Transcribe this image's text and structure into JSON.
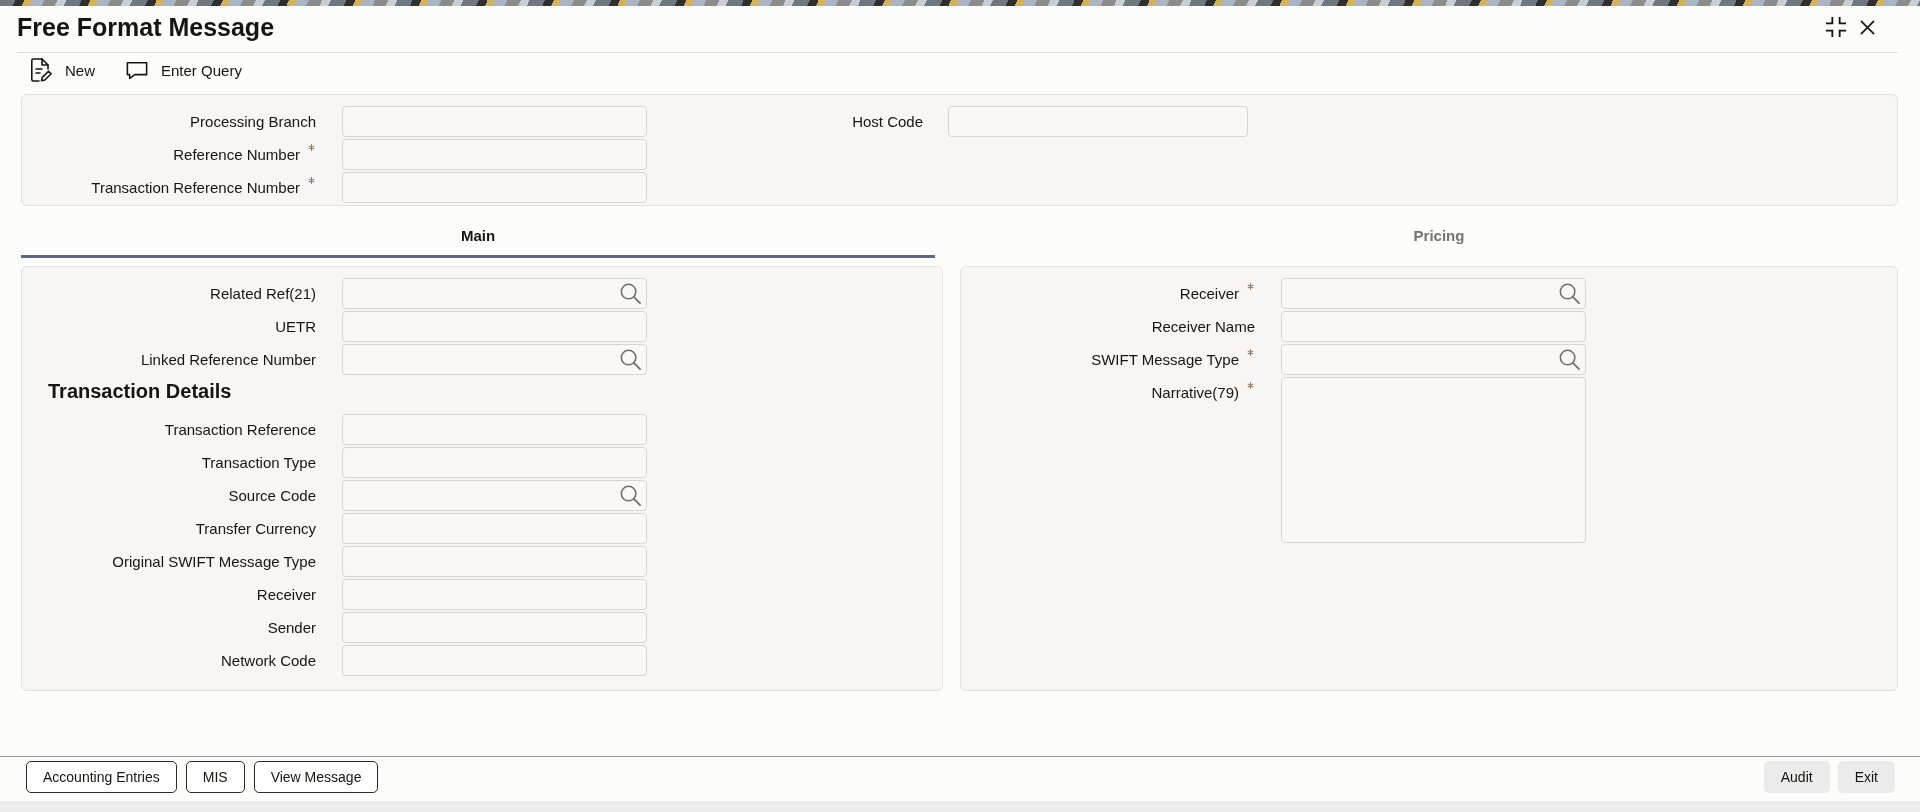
{
  "window": {
    "title": "Free Format Message"
  },
  "toolbar": [
    {
      "kind": "new",
      "label": "New"
    },
    {
      "kind": "query",
      "label": "Enter Query"
    }
  ],
  "header_fields": {
    "left": [
      {
        "label": "Processing Branch",
        "required": false,
        "kind": "text"
      },
      {
        "label": "Reference Number",
        "required": true,
        "kind": "text"
      },
      {
        "label": "Transaction Reference Number",
        "required": true,
        "kind": "text"
      }
    ],
    "right": [
      {
        "label": "Host Code",
        "required": false,
        "kind": "text"
      }
    ]
  },
  "tabs": [
    {
      "label": "Main",
      "selected": true
    },
    {
      "label": "Pricing",
      "selected": false
    }
  ],
  "main_panel": {
    "fields": [
      {
        "label": "Related Ref(21)",
        "required": false,
        "kind": "lookup"
      },
      {
        "label": "UETR",
        "required": false,
        "kind": "text"
      },
      {
        "label": "Linked Reference Number",
        "required": false,
        "kind": "lookup"
      }
    ],
    "section_title": "Transaction Details",
    "section_fields": [
      {
        "label": "Transaction Reference",
        "required": false,
        "kind": "text"
      },
      {
        "label": "Transaction Type",
        "required": false,
        "kind": "text"
      },
      {
        "label": "Source Code",
        "required": false,
        "kind": "lookup"
      },
      {
        "label": "Transfer Currency",
        "required": false,
        "kind": "text"
      },
      {
        "label": "Original SWIFT Message Type",
        "required": false,
        "kind": "text"
      },
      {
        "label": "Receiver",
        "required": false,
        "kind": "text"
      },
      {
        "label": "Sender",
        "required": false,
        "kind": "text"
      },
      {
        "label": "Network Code",
        "required": false,
        "kind": "text"
      }
    ]
  },
  "pricing_panel": {
    "fields": [
      {
        "label": "Receiver",
        "required": true,
        "kind": "lookup"
      },
      {
        "label": "Receiver Name",
        "required": false,
        "kind": "text"
      },
      {
        "label": "SWIFT Message Type",
        "required": true,
        "kind": "lookup"
      },
      {
        "label": "Narrative(79)",
        "required": true,
        "kind": "textarea"
      }
    ]
  },
  "footer": {
    "left_buttons": [
      "Accounting Entries",
      "MIS",
      "View Message"
    ],
    "right_buttons": [
      "Audit",
      "Exit"
    ]
  }
}
